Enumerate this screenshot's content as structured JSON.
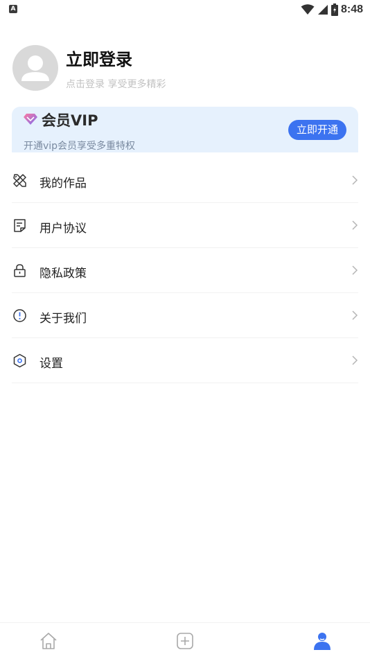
{
  "status_bar": {
    "notification_badge": "A",
    "time": "8:48"
  },
  "profile": {
    "title": "立即登录",
    "subtitle": "点击登录 享受更多精彩"
  },
  "vip": {
    "title": "会员VIP",
    "subtitle": "开通vip会员享受多重特权",
    "button_label": "立即开通",
    "accent_color": "#3c73f0"
  },
  "menu": {
    "items": [
      {
        "label": "我的作品",
        "icon": "pencil-ruler-icon"
      },
      {
        "label": "用户协议",
        "icon": "document-icon"
      },
      {
        "label": "隐私政策",
        "icon": "lock-icon"
      },
      {
        "label": "关于我们",
        "icon": "info-icon"
      },
      {
        "label": "设置",
        "icon": "hexagon-settings-icon"
      }
    ]
  },
  "bottom_nav": {
    "items": [
      {
        "name": "home",
        "icon": "home-icon",
        "active": false
      },
      {
        "name": "create",
        "icon": "add-square-icon",
        "active": false
      },
      {
        "name": "profile",
        "icon": "person-icon",
        "active": true
      }
    ]
  }
}
